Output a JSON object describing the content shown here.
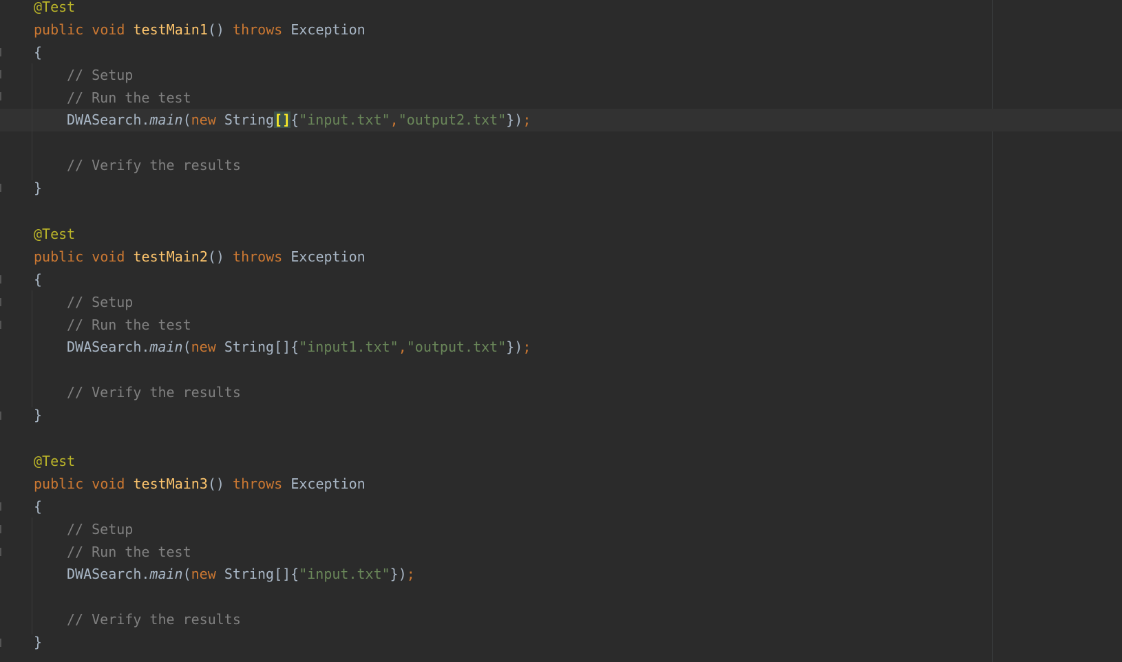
{
  "editor": {
    "colors": {
      "background": "#2b2b2b",
      "keyword": "#cc7832",
      "annotation": "#bbb529",
      "method_declaration": "#ffc66d",
      "comment": "#808080",
      "string": "#6a8759",
      "plain": "#a9b7c6",
      "brace_match": "#ffef28",
      "current_line": "#323232"
    },
    "tokens": {
      "annotation": "@Test",
      "public": "public",
      "void": "void",
      "throws": "throws",
      "exception": "Exception",
      "parens": "()",
      "open_brace": "{",
      "close_brace": "}",
      "class_name": "DWASearch",
      "dot": ".",
      "method_call": "main",
      "open_paren": "(",
      "new": "new",
      "string_type": "String",
      "array_brackets": "[]",
      "close_call": "})",
      "semicolon": ";",
      "comma": ","
    },
    "comments": {
      "setup": "// Setup",
      "run": "// Run the test",
      "verify": "// Verify the results"
    },
    "methods": [
      {
        "name": "testMain1",
        "args": [
          "\"input.txt\"",
          "\"output2.txt\""
        ]
      },
      {
        "name": "testMain2",
        "args": [
          "\"input1.txt\"",
          "\"output.txt\""
        ]
      },
      {
        "name": "testMain3",
        "args": [
          "\"input.txt\""
        ]
      }
    ]
  }
}
